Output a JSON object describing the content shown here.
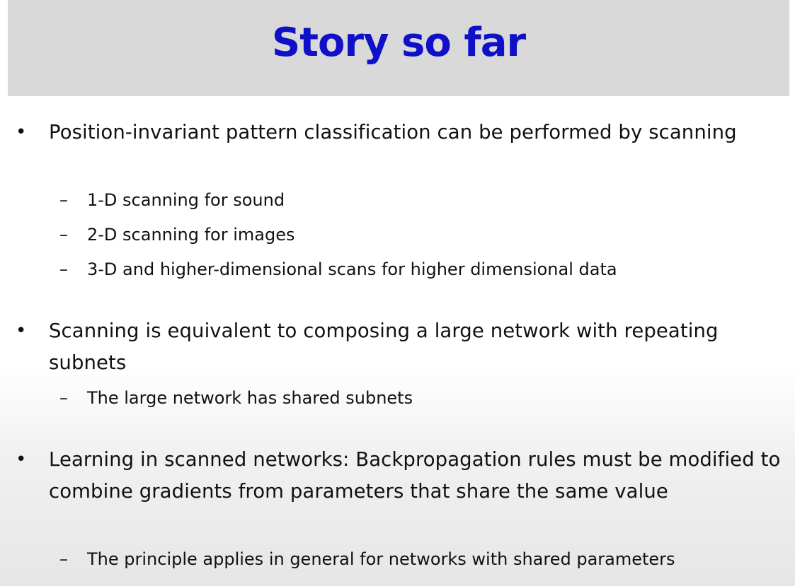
{
  "slide": {
    "title": "Story so far",
    "bullet_symbol": "•",
    "sub_bullet_symbol": "–",
    "bullets": [
      {
        "text": "Position-invariant pattern classification can be performed by scanning",
        "subs": [
          "1-D scanning for sound",
          "2-D scanning for images",
          "3-D and higher-dimensional scans for higher dimensional data"
        ]
      },
      {
        "text": "Scanning is equivalent to composing a large network with repeating subnets",
        "subs": [
          "The large network has shared subnets"
        ]
      },
      {
        "text": "Learning in scanned networks: Backpropagation rules must be modified to combine gradients from parameters that share the same value",
        "subs": [
          "The principle applies in general for networks with shared parameters"
        ]
      }
    ]
  },
  "colors": {
    "title": "#1010c8",
    "title_bar": "#d9d9d9",
    "text": "#111111"
  }
}
